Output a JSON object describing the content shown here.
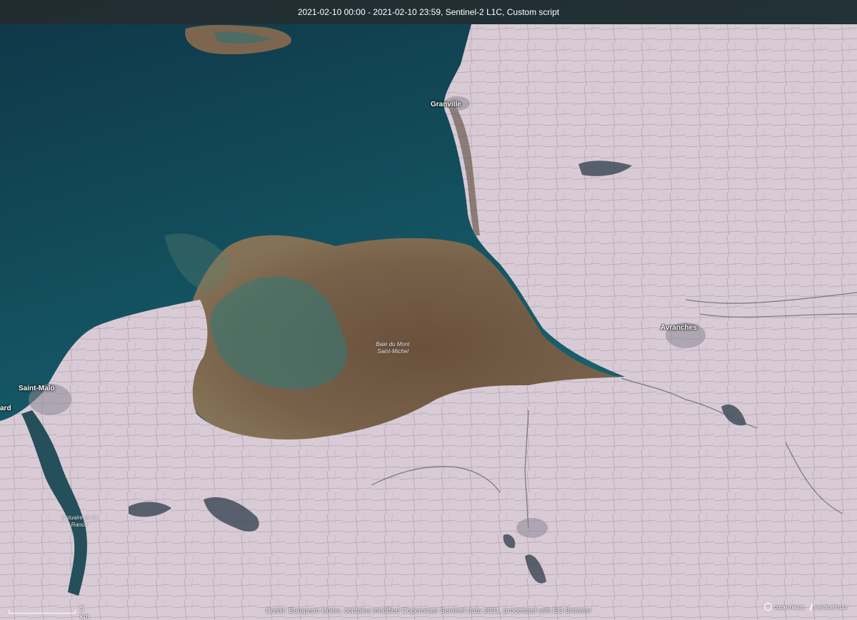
{
  "header": {
    "info": "2021-02-10 00:00 - 2021-02-10 23:59, Sentinel-2 L1C, Custom script"
  },
  "places": {
    "granville": "Granville",
    "saint_malo": "Saint-Malo",
    "avranches": "Avranches",
    "dinard_fragment": "ard"
  },
  "regions": {
    "bay_line1": "Baie du Mont",
    "bay_line2": "Saint-Michel",
    "rance_line1": "Estuaire de la",
    "rance_line2": "Rance"
  },
  "footer": {
    "credit": "Credit: European Union, contains modified Copernicus Sentinel data 2021, processed with EO Browser",
    "scale_label": "5 km",
    "logo_copernicus": "copernicus",
    "logo_sentinelhub": "sentinelhub"
  },
  "colors": {
    "sea_deep": "#0f3b4a",
    "sea_teal": "#1f6b72",
    "sediment": "#7a5e44",
    "snow_land": "#d9ccd6",
    "dark_land": "#2f3a45"
  }
}
